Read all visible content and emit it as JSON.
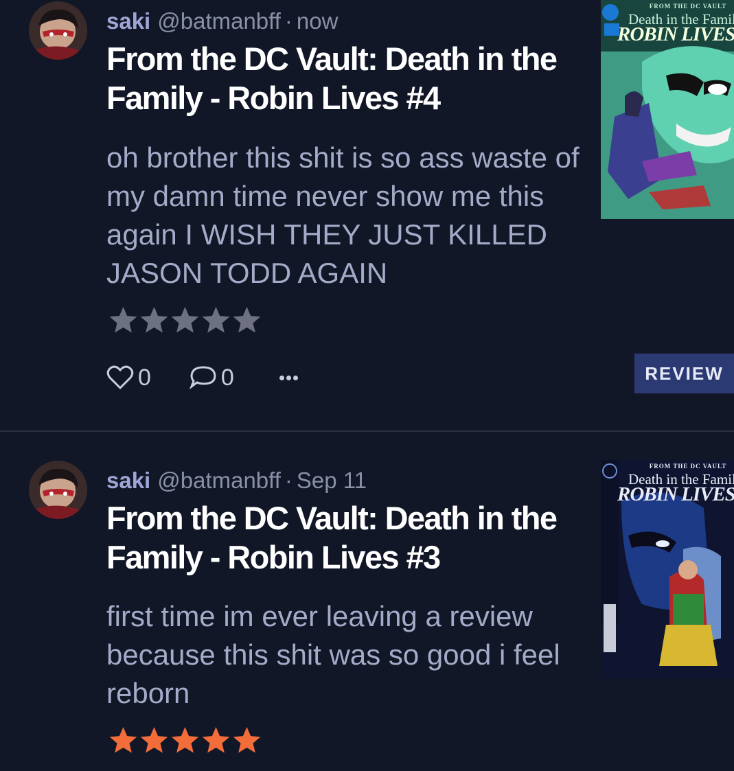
{
  "reviews": [
    {
      "username": "saki",
      "handle": "@batmanbff",
      "separator": "·",
      "time": "now",
      "title": "From the DC Vault: Death in the Family - Robin Lives #4",
      "body": "oh brother this shit is so ass waste of my damn time never show me this again I WISH THEY JUST KILLED JASON TODD AGAIN",
      "rating": 0,
      "likes": "0",
      "comments": "0",
      "review_button": "REVIEW",
      "cover": {
        "sup": "FROM THE DC VAULT",
        "line1": "Death in the Family",
        "line2": "ROBIN LIVES!",
        "palette": "teal-green"
      }
    },
    {
      "username": "saki",
      "handle": "@batmanbff",
      "separator": "·",
      "time": "Sep 11",
      "title": "From the DC Vault: Death in the Family - Robin Lives #3",
      "body": "first time im ever leaving a review because this shit was so good i feel reborn",
      "rating": 5,
      "cover": {
        "sup": "FROM THE DC VAULT",
        "line1": "Death in the Family",
        "line2": "ROBIN LIVES!",
        "palette": "dark-blue"
      }
    }
  ],
  "colors": {
    "background": "#121727",
    "username": "#9fa6d6",
    "muted": "#8a91a6",
    "title": "#ffffff",
    "body": "#a4abc8",
    "star_empty": "#6d7181",
    "star_filled": "#f26d3a",
    "button_bg": "#2b3a73"
  },
  "icons": [
    "avatar",
    "heart-icon",
    "comment-icon",
    "more-icon",
    "star-icon",
    "comic-cover"
  ]
}
